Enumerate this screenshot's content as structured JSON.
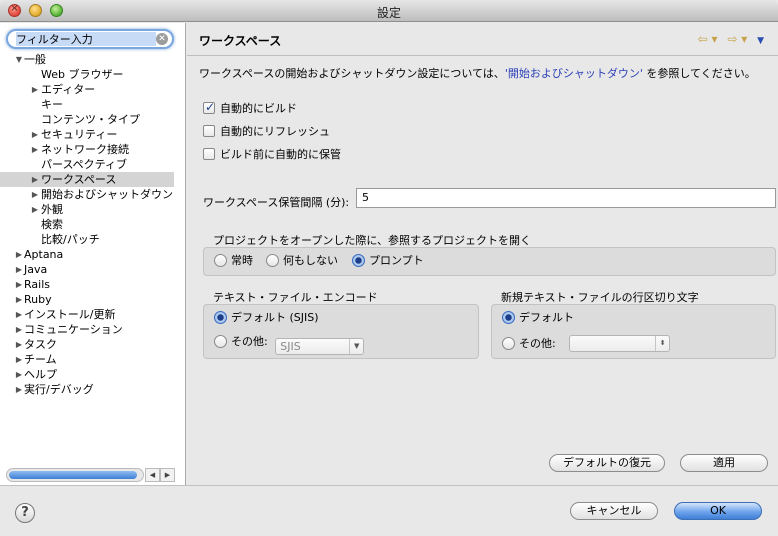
{
  "window": {
    "title": "設定"
  },
  "sidebar": {
    "filter_placeholder": "フィルター入力",
    "filter_value": "フィルター入力",
    "tree": [
      {
        "label": "一般",
        "depth": 0,
        "expanded": true
      },
      {
        "label": "Web ブラウザー",
        "depth": 1
      },
      {
        "label": "エディター",
        "depth": 1,
        "collapsed": true
      },
      {
        "label": "キー",
        "depth": 1
      },
      {
        "label": "コンテンツ・タイプ",
        "depth": 1
      },
      {
        "label": "セキュリティー",
        "depth": 1,
        "collapsed": true
      },
      {
        "label": "ネットワーク接続",
        "depth": 1,
        "collapsed": true
      },
      {
        "label": "パースペクティブ",
        "depth": 1
      },
      {
        "label": "ワークスペース",
        "depth": 1,
        "collapsed": true,
        "selected": true
      },
      {
        "label": "開始およびシャットダウン",
        "depth": 1,
        "collapsed": true
      },
      {
        "label": "外観",
        "depth": 1,
        "collapsed": true
      },
      {
        "label": "検索",
        "depth": 1
      },
      {
        "label": "比較/パッチ",
        "depth": 1
      },
      {
        "label": "Aptana",
        "depth": 0,
        "collapsed": true
      },
      {
        "label": "Java",
        "depth": 0,
        "collapsed": true
      },
      {
        "label": "Rails",
        "depth": 0,
        "collapsed": true
      },
      {
        "label": "Ruby",
        "depth": 0,
        "collapsed": true
      },
      {
        "label": "インストール/更新",
        "depth": 0,
        "collapsed": true
      },
      {
        "label": "コミュニケーション",
        "depth": 0,
        "collapsed": true
      },
      {
        "label": "タスク",
        "depth": 0,
        "collapsed": true
      },
      {
        "label": "チーム",
        "depth": 0,
        "collapsed": true
      },
      {
        "label": "ヘルプ",
        "depth": 0,
        "collapsed": true
      },
      {
        "label": "実行/デバッグ",
        "depth": 0,
        "collapsed": true
      }
    ]
  },
  "main": {
    "title": "ワークスペース",
    "description_prefix": "ワークスペースの開始およびシャットダウン設定については、",
    "description_link": "'開始およびシャットダウン'",
    "description_suffix": " を参照してください。",
    "checkboxes": {
      "auto_build": "自動的にビルド",
      "auto_refresh": "自動的にリフレッシュ",
      "save_before_build": "ビルド前に自動的に保管"
    },
    "interval": {
      "label": "ワークスペース保管間隔 (分):",
      "value": "5"
    },
    "open_projects": {
      "label": "プロジェクトをオープンした際に、参照するプロジェクトを開く",
      "options": [
        "常時",
        "何もしない",
        "プロンプト"
      ],
      "selected": "プロンプト"
    },
    "encoding": {
      "label": "テキスト・ファイル・エンコード",
      "default_option": "デフォルト (SJIS)",
      "other_option": "その他:",
      "other_value": "SJIS"
    },
    "line_delimiter": {
      "label": "新規テキスト・ファイルの行区切り文字",
      "default_option": "デフォルト",
      "other_option": "その他:",
      "other_value": ""
    },
    "restore_defaults": "デフォルトの復元",
    "apply": "適用"
  },
  "footer": {
    "help": "?",
    "cancel": "キャンセル",
    "ok": "OK"
  },
  "colors": {
    "accent": "#3f7fd6",
    "link": "#2b3fb8"
  }
}
